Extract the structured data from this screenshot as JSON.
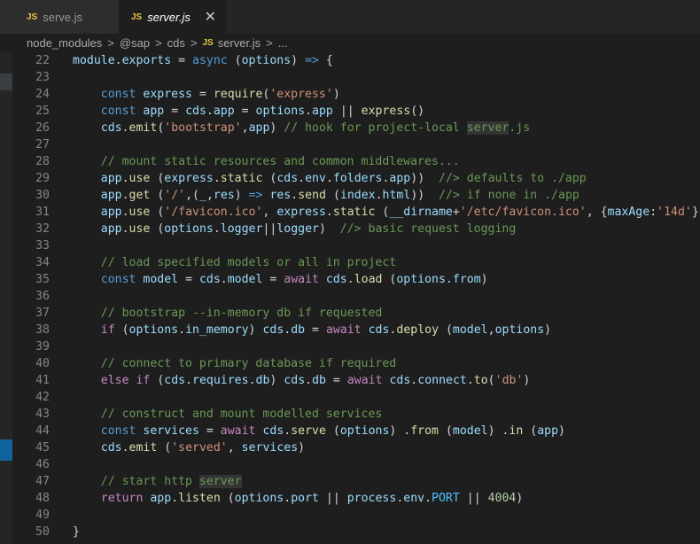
{
  "tabs": [
    {
      "icon": "JS",
      "label": "serve.js"
    },
    {
      "icon": "JS",
      "label": "server.js",
      "close": "✕"
    }
  ],
  "breadcrumb": {
    "items": [
      "node_modules",
      "@sap",
      "cds"
    ],
    "file_icon": "JS",
    "file": "server.js",
    "tail": "...",
    "separator": ">"
  },
  "code": {
    "line_numbers": [
      "22",
      "23",
      "24",
      "25",
      "26",
      "27",
      "28",
      "29",
      "30",
      "31",
      "32",
      "33",
      "34",
      "35",
      "36",
      "37",
      "38",
      "39",
      "40",
      "41",
      "42",
      "43",
      "44",
      "45",
      "46",
      "47",
      "48",
      "49",
      "50"
    ],
    "lines": [
      [
        {
          "t": "module",
          "c": "v"
        },
        {
          "t": ".",
          "c": ""
        },
        {
          "t": "exports",
          "c": "v"
        },
        {
          "t": " = ",
          "c": ""
        },
        {
          "t": "async",
          "c": "k"
        },
        {
          "t": " (",
          "c": ""
        },
        {
          "t": "options",
          "c": "v"
        },
        {
          "t": ") ",
          "c": ""
        },
        {
          "t": "=>",
          "c": "k"
        },
        {
          "t": " {",
          "c": ""
        }
      ],
      [],
      [
        {
          "t": "    ",
          "c": ""
        },
        {
          "t": "const",
          "c": "k"
        },
        {
          "t": " ",
          "c": ""
        },
        {
          "t": "express",
          "c": "v"
        },
        {
          "t": " = ",
          "c": ""
        },
        {
          "t": "require",
          "c": "f"
        },
        {
          "t": "(",
          "c": ""
        },
        {
          "t": "'express'",
          "c": "s"
        },
        {
          "t": ")",
          "c": ""
        }
      ],
      [
        {
          "t": "    ",
          "c": ""
        },
        {
          "t": "const",
          "c": "k"
        },
        {
          "t": " ",
          "c": ""
        },
        {
          "t": "app",
          "c": "v"
        },
        {
          "t": " = ",
          "c": ""
        },
        {
          "t": "cds",
          "c": "v"
        },
        {
          "t": ".",
          "c": ""
        },
        {
          "t": "app",
          "c": "v"
        },
        {
          "t": " = ",
          "c": ""
        },
        {
          "t": "options",
          "c": "v"
        },
        {
          "t": ".",
          "c": ""
        },
        {
          "t": "app",
          "c": "v"
        },
        {
          "t": " || ",
          "c": ""
        },
        {
          "t": "express",
          "c": "f"
        },
        {
          "t": "()",
          "c": ""
        }
      ],
      [
        {
          "t": "    ",
          "c": ""
        },
        {
          "t": "cds",
          "c": "v"
        },
        {
          "t": ".",
          "c": ""
        },
        {
          "t": "emit",
          "c": "f"
        },
        {
          "t": "(",
          "c": ""
        },
        {
          "t": "'bootstrap'",
          "c": "s"
        },
        {
          "t": ",",
          "c": ""
        },
        {
          "t": "app",
          "c": "v"
        },
        {
          "t": ") ",
          "c": ""
        },
        {
          "t": "// hook for project-local ",
          "c": "c"
        },
        {
          "t": "server",
          "c": "c",
          "h": true
        },
        {
          "t": ".js",
          "c": "c"
        }
      ],
      [],
      [
        {
          "t": "    ",
          "c": ""
        },
        {
          "t": "// mount static resources and common middlewares...",
          "c": "c"
        }
      ],
      [
        {
          "t": "    ",
          "c": ""
        },
        {
          "t": "app",
          "c": "v"
        },
        {
          "t": ".",
          "c": ""
        },
        {
          "t": "use",
          "c": "f"
        },
        {
          "t": " (",
          "c": ""
        },
        {
          "t": "express",
          "c": "v"
        },
        {
          "t": ".",
          "c": ""
        },
        {
          "t": "static",
          "c": "f"
        },
        {
          "t": " (",
          "c": ""
        },
        {
          "t": "cds",
          "c": "v"
        },
        {
          "t": ".",
          "c": ""
        },
        {
          "t": "env",
          "c": "v"
        },
        {
          "t": ".",
          "c": ""
        },
        {
          "t": "folders",
          "c": "v"
        },
        {
          "t": ".",
          "c": ""
        },
        {
          "t": "app",
          "c": "v"
        },
        {
          "t": "))  ",
          "c": ""
        },
        {
          "t": "//> defaults to ./app",
          "c": "c"
        }
      ],
      [
        {
          "t": "    ",
          "c": ""
        },
        {
          "t": "app",
          "c": "v"
        },
        {
          "t": ".",
          "c": ""
        },
        {
          "t": "get",
          "c": "f"
        },
        {
          "t": " (",
          "c": ""
        },
        {
          "t": "'/'",
          "c": "s"
        },
        {
          "t": ",(",
          "c": ""
        },
        {
          "t": "_",
          "c": "v"
        },
        {
          "t": ",",
          "c": ""
        },
        {
          "t": "res",
          "c": "v"
        },
        {
          "t": ") ",
          "c": ""
        },
        {
          "t": "=>",
          "c": "k"
        },
        {
          "t": " ",
          "c": ""
        },
        {
          "t": "res",
          "c": "v"
        },
        {
          "t": ".",
          "c": ""
        },
        {
          "t": "send",
          "c": "f"
        },
        {
          "t": " (",
          "c": ""
        },
        {
          "t": "index",
          "c": "v"
        },
        {
          "t": ".",
          "c": ""
        },
        {
          "t": "html",
          "c": "v"
        },
        {
          "t": "))  ",
          "c": ""
        },
        {
          "t": "//> if none in ./app",
          "c": "c"
        }
      ],
      [
        {
          "t": "    ",
          "c": ""
        },
        {
          "t": "app",
          "c": "v"
        },
        {
          "t": ".",
          "c": ""
        },
        {
          "t": "use",
          "c": "f"
        },
        {
          "t": " (",
          "c": ""
        },
        {
          "t": "'/favicon.ico'",
          "c": "s"
        },
        {
          "t": ", ",
          "c": ""
        },
        {
          "t": "express",
          "c": "v"
        },
        {
          "t": ".",
          "c": ""
        },
        {
          "t": "static",
          "c": "f"
        },
        {
          "t": " (",
          "c": ""
        },
        {
          "t": "__dirname",
          "c": "v"
        },
        {
          "t": "+",
          "c": ""
        },
        {
          "t": "'/etc/favicon.ico'",
          "c": "s"
        },
        {
          "t": ", {",
          "c": ""
        },
        {
          "t": "maxAge",
          "c": "v"
        },
        {
          "t": ":",
          "c": ""
        },
        {
          "t": "'14d'",
          "c": "s"
        },
        {
          "t": "}))",
          "c": ""
        }
      ],
      [
        {
          "t": "    ",
          "c": ""
        },
        {
          "t": "app",
          "c": "v"
        },
        {
          "t": ".",
          "c": ""
        },
        {
          "t": "use",
          "c": "f"
        },
        {
          "t": " (",
          "c": ""
        },
        {
          "t": "options",
          "c": "v"
        },
        {
          "t": ".",
          "c": ""
        },
        {
          "t": "logger",
          "c": "v"
        },
        {
          "t": "||",
          "c": ""
        },
        {
          "t": "logger",
          "c": "v"
        },
        {
          "t": ")  ",
          "c": ""
        },
        {
          "t": "//> basic request logging",
          "c": "c"
        }
      ],
      [],
      [
        {
          "t": "    ",
          "c": ""
        },
        {
          "t": "// load specified models or all in project",
          "c": "c"
        }
      ],
      [
        {
          "t": "    ",
          "c": ""
        },
        {
          "t": "const",
          "c": "k"
        },
        {
          "t": " ",
          "c": ""
        },
        {
          "t": "model",
          "c": "v"
        },
        {
          "t": " = ",
          "c": ""
        },
        {
          "t": "cds",
          "c": "v"
        },
        {
          "t": ".",
          "c": ""
        },
        {
          "t": "model",
          "c": "v"
        },
        {
          "t": " = ",
          "c": ""
        },
        {
          "t": "await",
          "c": "kc"
        },
        {
          "t": " ",
          "c": ""
        },
        {
          "t": "cds",
          "c": "v"
        },
        {
          "t": ".",
          "c": ""
        },
        {
          "t": "load",
          "c": "f"
        },
        {
          "t": " (",
          "c": ""
        },
        {
          "t": "options",
          "c": "v"
        },
        {
          "t": ".",
          "c": ""
        },
        {
          "t": "from",
          "c": "v"
        },
        {
          "t": ")",
          "c": ""
        }
      ],
      [],
      [
        {
          "t": "    ",
          "c": ""
        },
        {
          "t": "// bootstrap --in-memory db if requested",
          "c": "c"
        }
      ],
      [
        {
          "t": "    ",
          "c": ""
        },
        {
          "t": "if",
          "c": "kc"
        },
        {
          "t": " (",
          "c": ""
        },
        {
          "t": "options",
          "c": "v"
        },
        {
          "t": ".",
          "c": ""
        },
        {
          "t": "in_memory",
          "c": "v"
        },
        {
          "t": ") ",
          "c": ""
        },
        {
          "t": "cds",
          "c": "v"
        },
        {
          "t": ".",
          "c": ""
        },
        {
          "t": "db",
          "c": "v"
        },
        {
          "t": " = ",
          "c": ""
        },
        {
          "t": "await",
          "c": "kc"
        },
        {
          "t": " ",
          "c": ""
        },
        {
          "t": "cds",
          "c": "v"
        },
        {
          "t": ".",
          "c": ""
        },
        {
          "t": "deploy",
          "c": "f"
        },
        {
          "t": " (",
          "c": ""
        },
        {
          "t": "model",
          "c": "v"
        },
        {
          "t": ",",
          "c": ""
        },
        {
          "t": "options",
          "c": "v"
        },
        {
          "t": ")",
          "c": ""
        }
      ],
      [],
      [
        {
          "t": "    ",
          "c": ""
        },
        {
          "t": "// connect to primary database if required",
          "c": "c"
        }
      ],
      [
        {
          "t": "    ",
          "c": ""
        },
        {
          "t": "else",
          "c": "kc"
        },
        {
          "t": " ",
          "c": ""
        },
        {
          "t": "if",
          "c": "kc"
        },
        {
          "t": " (",
          "c": ""
        },
        {
          "t": "cds",
          "c": "v"
        },
        {
          "t": ".",
          "c": ""
        },
        {
          "t": "requires",
          "c": "v"
        },
        {
          "t": ".",
          "c": ""
        },
        {
          "t": "db",
          "c": "v"
        },
        {
          "t": ") ",
          "c": ""
        },
        {
          "t": "cds",
          "c": "v"
        },
        {
          "t": ".",
          "c": ""
        },
        {
          "t": "db",
          "c": "v"
        },
        {
          "t": " = ",
          "c": ""
        },
        {
          "t": "await",
          "c": "kc"
        },
        {
          "t": " ",
          "c": ""
        },
        {
          "t": "cds",
          "c": "v"
        },
        {
          "t": ".",
          "c": ""
        },
        {
          "t": "connect",
          "c": "v"
        },
        {
          "t": ".",
          "c": ""
        },
        {
          "t": "to",
          "c": "f"
        },
        {
          "t": "(",
          "c": ""
        },
        {
          "t": "'db'",
          "c": "s"
        },
        {
          "t": ")",
          "c": ""
        }
      ],
      [],
      [
        {
          "t": "    ",
          "c": ""
        },
        {
          "t": "// construct and mount modelled services",
          "c": "c"
        }
      ],
      [
        {
          "t": "    ",
          "c": ""
        },
        {
          "t": "const",
          "c": "k"
        },
        {
          "t": " ",
          "c": ""
        },
        {
          "t": "services",
          "c": "v"
        },
        {
          "t": " = ",
          "c": ""
        },
        {
          "t": "await",
          "c": "kc"
        },
        {
          "t": " ",
          "c": ""
        },
        {
          "t": "cds",
          "c": "v"
        },
        {
          "t": ".",
          "c": ""
        },
        {
          "t": "serve",
          "c": "f"
        },
        {
          "t": " (",
          "c": ""
        },
        {
          "t": "options",
          "c": "v"
        },
        {
          "t": ") .",
          "c": ""
        },
        {
          "t": "from",
          "c": "f"
        },
        {
          "t": " (",
          "c": ""
        },
        {
          "t": "model",
          "c": "v"
        },
        {
          "t": ") .",
          "c": ""
        },
        {
          "t": "in",
          "c": "f"
        },
        {
          "t": " (",
          "c": ""
        },
        {
          "t": "app",
          "c": "v"
        },
        {
          "t": ")",
          "c": ""
        }
      ],
      [
        {
          "t": "    ",
          "c": ""
        },
        {
          "t": "cds",
          "c": "v"
        },
        {
          "t": ".",
          "c": ""
        },
        {
          "t": "emit",
          "c": "f"
        },
        {
          "t": " (",
          "c": ""
        },
        {
          "t": "'served'",
          "c": "s"
        },
        {
          "t": ", ",
          "c": ""
        },
        {
          "t": "services",
          "c": "v"
        },
        {
          "t": ")",
          "c": ""
        }
      ],
      [],
      [
        {
          "t": "    ",
          "c": ""
        },
        {
          "t": "// start http ",
          "c": "c"
        },
        {
          "t": "server",
          "c": "c",
          "h": true
        }
      ],
      [
        {
          "t": "    ",
          "c": ""
        },
        {
          "t": "return",
          "c": "kc"
        },
        {
          "t": " ",
          "c": ""
        },
        {
          "t": "app",
          "c": "v"
        },
        {
          "t": ".",
          "c": ""
        },
        {
          "t": "listen",
          "c": "f"
        },
        {
          "t": " (",
          "c": ""
        },
        {
          "t": "options",
          "c": "v"
        },
        {
          "t": ".",
          "c": ""
        },
        {
          "t": "port",
          "c": "v"
        },
        {
          "t": " || ",
          "c": ""
        },
        {
          "t": "process",
          "c": "v"
        },
        {
          "t": ".",
          "c": ""
        },
        {
          "t": "env",
          "c": "v"
        },
        {
          "t": ".",
          "c": ""
        },
        {
          "t": "PORT",
          "c": "cn"
        },
        {
          "t": " || ",
          "c": ""
        },
        {
          "t": "4004",
          "c": "n"
        },
        {
          "t": ")",
          "c": ""
        }
      ],
      [],
      [
        {
          "t": "}",
          "c": ""
        }
      ]
    ]
  },
  "colors": {
    "editor_bg": "#1e1e1e",
    "tabbar_bg": "#252526",
    "keyword": "#569cd6",
    "control": "#c586c0",
    "variable": "#9cdcfe",
    "function": "#dcdcaa",
    "string": "#ce9178",
    "comment": "#6a9955",
    "number": "#b5cea8",
    "constant": "#4fc1ff",
    "js_icon": "#e8c547"
  }
}
